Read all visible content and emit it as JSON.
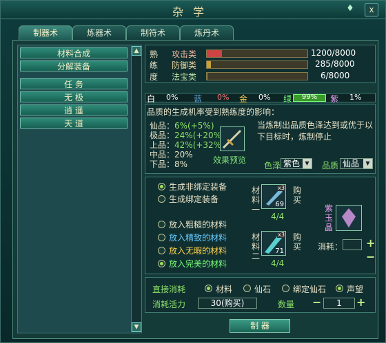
{
  "window": {
    "title": "杂学",
    "pin_icon": "jade-pin-icon",
    "close_label": "x"
  },
  "tabs": [
    {
      "label": "制器术",
      "active": true
    },
    {
      "label": "炼器术",
      "active": false
    },
    {
      "label": "制符术",
      "active": false
    },
    {
      "label": "炼丹术",
      "active": false
    }
  ],
  "left_menu": [
    {
      "label": "材料合成"
    },
    {
      "label": "分解装备"
    },
    {
      "label": "任 务"
    },
    {
      "label": "无 极"
    },
    {
      "label": "逍 遥"
    },
    {
      "label": "天 道"
    }
  ],
  "proficiency": {
    "section_chars": [
      "熟",
      "练",
      "度"
    ],
    "items": [
      {
        "label": "攻击类",
        "value": "1200/8000",
        "color": "#c44"
      },
      {
        "label": "防御类",
        "value": "285/8000",
        "color": "#c9a23a"
      },
      {
        "label": "法宝类",
        "value": "6/8000",
        "color": "#6a4"
      }
    ]
  },
  "quality_rates": [
    {
      "label": "白",
      "value": "0%",
      "color": "#fff"
    },
    {
      "label": "蓝",
      "value": "0%",
      "color": "#6ad"
    },
    {
      "label": "金",
      "value": "0%",
      "color": "#ffd34a"
    },
    {
      "label": "绿",
      "value": "99%",
      "color": "#7f7"
    },
    {
      "label": "紫",
      "value": "1%",
      "color": "#e7a0f0"
    }
  ],
  "quality_info": {
    "heading": "品质的生成机率受到熟练度的影响：",
    "lines": [
      {
        "name": "仙品：",
        "value": "6%(+5%)"
      },
      {
        "name": "极品：",
        "value": "24%(+20%)"
      },
      {
        "name": "上品：",
        "value": "42%(+32%)"
      },
      {
        "name": "中品：",
        "value": "20%"
      },
      {
        "name": "下品：",
        "value": "8%"
      }
    ],
    "preview_label": "效果预览",
    "note": "当炼制出品质色泽达到或优于以下目标时，炼制停止",
    "color_label": "色泽",
    "color_value": "紫色",
    "quality_label": "品质",
    "quality_value": "仙品"
  },
  "binding": {
    "options": [
      {
        "label": "生成非绑定装备",
        "selected": true
      },
      {
        "label": "生成绑定装备",
        "selected": false
      }
    ]
  },
  "materials_quality": [
    {
      "label": "放入粗糙的材料",
      "selected": false,
      "color": "#e8e3c8"
    },
    {
      "label": "放入精致的材料",
      "selected": false,
      "color": "#6cf"
    },
    {
      "label": "放入无暇的材料",
      "selected": false,
      "color": "#ffd34a"
    },
    {
      "label": "放入完美的材料",
      "selected": true,
      "color": "#7f7"
    }
  ],
  "materials": [
    {
      "side_label": "材料一",
      "badge": "x3",
      "count": "69",
      "progress": "4/4",
      "buy": "购买"
    },
    {
      "side_label": "材料二",
      "badge": "x3",
      "count": "71",
      "progress": "4/4",
      "buy": "购买"
    }
  ],
  "gem": {
    "label": "紫玉晶",
    "consume_label": "消耗："
  },
  "bottom": {
    "direct_label": "直接消耗",
    "consume_options": [
      {
        "label": "材料",
        "selected": true
      },
      {
        "label": "仙石",
        "selected": false
      },
      {
        "label": "绑定仙石",
        "selected": false
      },
      {
        "label": "声望",
        "selected": true
      }
    ],
    "vigor_label": "消耗活力",
    "vigor_value": "30(购买)",
    "qty_label": "数量",
    "qty_value": "1",
    "make_label": "制 器"
  }
}
